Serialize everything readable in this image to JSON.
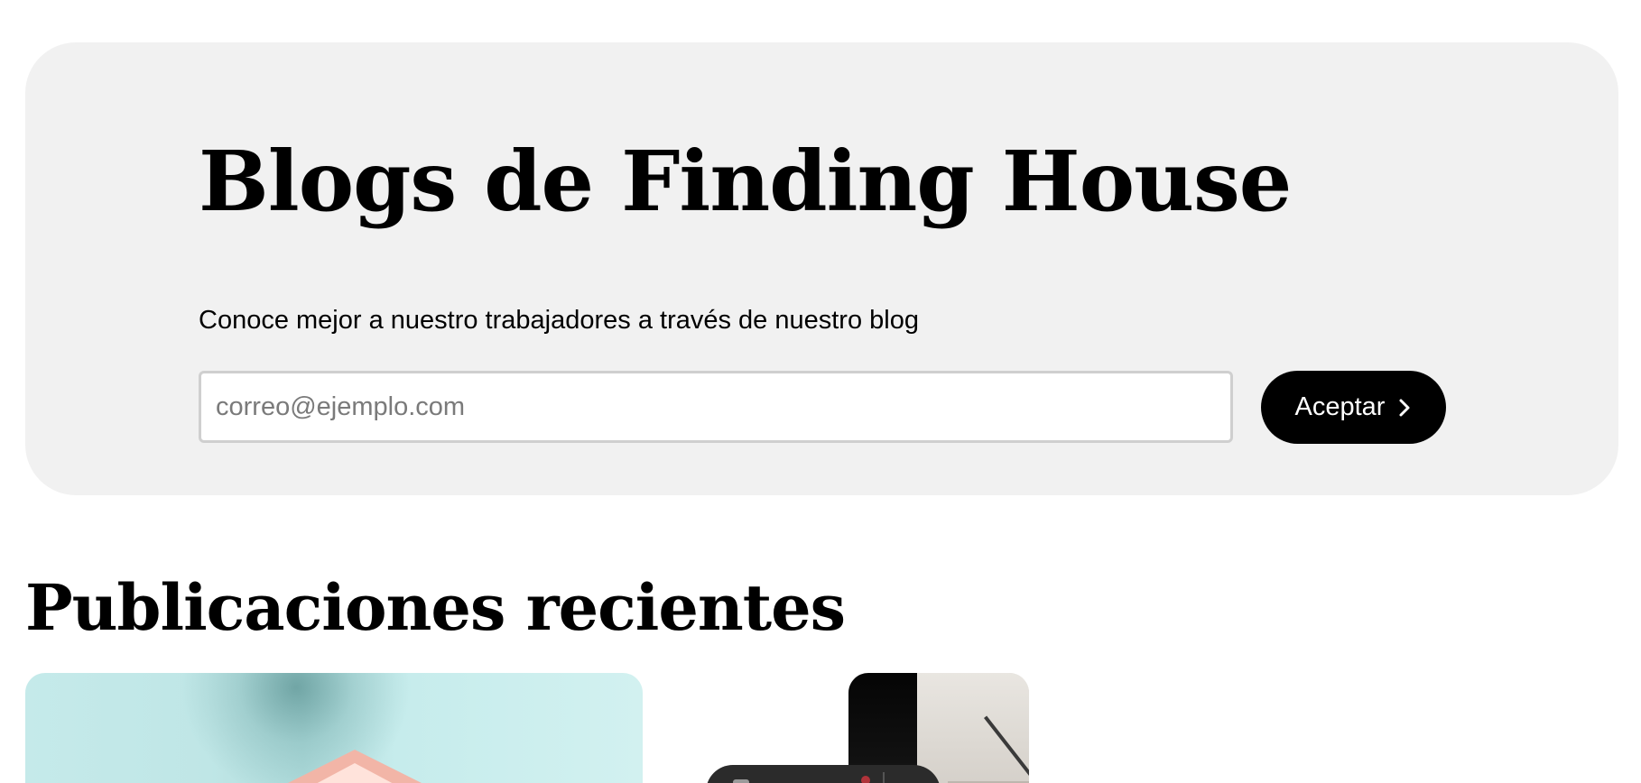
{
  "hero": {
    "title": "Blogs de Finding House",
    "subtitle": "Conoce mejor a nuestro trabajadores a través de nuestro blog",
    "email_placeholder": "correo@ejemplo.com",
    "email_value": "",
    "submit_label": "Aceptar",
    "submit_icon": "chevron-right-icon",
    "background_color": "#f1f1f1",
    "button_color": "#000000"
  },
  "recent_posts": {
    "title": "Publicaciones recientes",
    "cards": [
      {
        "image": "hands-house-roof-photo"
      },
      {
        "image": "staircase-interior-photo"
      }
    ]
  }
}
